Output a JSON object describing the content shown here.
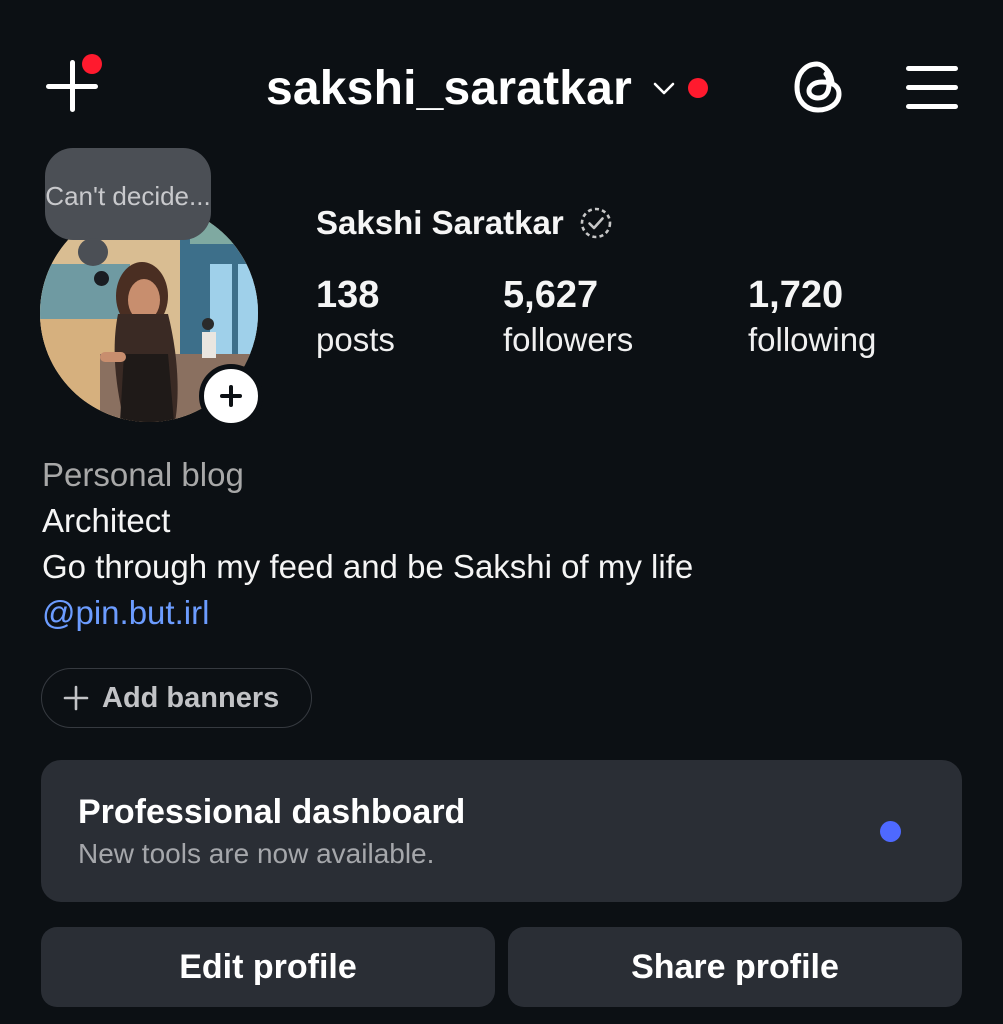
{
  "header": {
    "username": "sakshi_saratkar",
    "create_icon": "plus-icon",
    "threads_icon": "threads-icon",
    "menu_icon": "hamburger-menu-icon"
  },
  "profile": {
    "note": "Can't decide...",
    "full_name": "Sakshi Saratkar",
    "verified_icon": "dashed-verified-badge-icon"
  },
  "stats": [
    {
      "value": "138",
      "label": "posts"
    },
    {
      "value": "5,627",
      "label": "followers"
    },
    {
      "value": "1,720",
      "label": "following"
    }
  ],
  "bio": {
    "category": "Personal blog",
    "line1": "Architect",
    "line2": "Go through my feed and be Sakshi of my life",
    "link": "@pin.but.irl"
  },
  "banner_button": {
    "label": "Add banners"
  },
  "dashboard": {
    "title": "Professional dashboard",
    "subtitle": "New tools are now available."
  },
  "actions": {
    "edit": "Edit profile",
    "share": "Share profile"
  },
  "colors": {
    "background": "#0c1014",
    "surface": "#2a2e35",
    "notification_red": "#ff1a2e",
    "link_blue": "#6c9cff",
    "dashboard_dot": "#4e69ff"
  }
}
